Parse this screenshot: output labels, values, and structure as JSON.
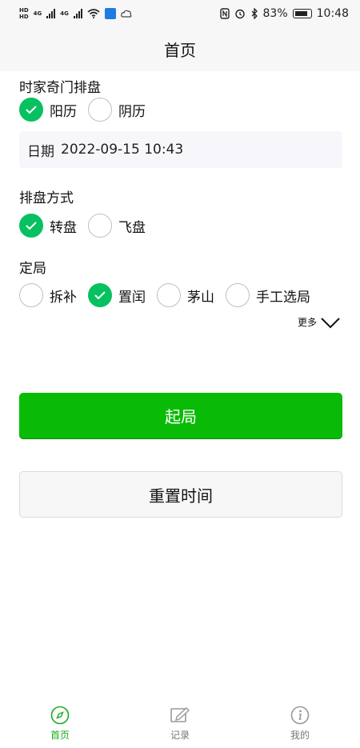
{
  "status_bar": {
    "hd1": "HD",
    "hd2": "HD",
    "net1": "4G",
    "net2": "4G",
    "battery_percent": "83%",
    "time": "10:48",
    "icons": [
      "hd-icon",
      "signal-icon",
      "wifi-icon",
      "app-icon",
      "cloud-icon",
      "nfc-icon",
      "alarm-icon",
      "bluetooth-icon",
      "battery-icon"
    ]
  },
  "header": {
    "title": "首页"
  },
  "form": {
    "calendar": {
      "title": "时家奇门排盘",
      "options": [
        {
          "label": "阳历",
          "checked": true
        },
        {
          "label": "阴历",
          "checked": false
        }
      ]
    },
    "date": {
      "label": "日期",
      "value": "2022-09-15 10:43"
    },
    "method": {
      "title": "排盘方式",
      "options": [
        {
          "label": "转盘",
          "checked": true
        },
        {
          "label": "飞盘",
          "checked": false
        }
      ]
    },
    "ju": {
      "title": "定局",
      "options": [
        {
          "label": "拆补",
          "checked": false
        },
        {
          "label": "置闰",
          "checked": true
        },
        {
          "label": "茅山",
          "checked": false
        },
        {
          "label": "手工选局",
          "checked": false
        }
      ]
    },
    "more_label": "更多"
  },
  "actions": {
    "primary_label": "起局",
    "secondary_label": "重置时间"
  },
  "tabbar": {
    "items": [
      {
        "label": "首页",
        "icon": "compass-icon",
        "active": true
      },
      {
        "label": "记录",
        "icon": "edit-icon",
        "active": false
      },
      {
        "label": "我的",
        "icon": "info-icon",
        "active": false
      }
    ]
  },
  "colors": {
    "accent": "#09bb07",
    "tab_active": "#1aad19"
  }
}
